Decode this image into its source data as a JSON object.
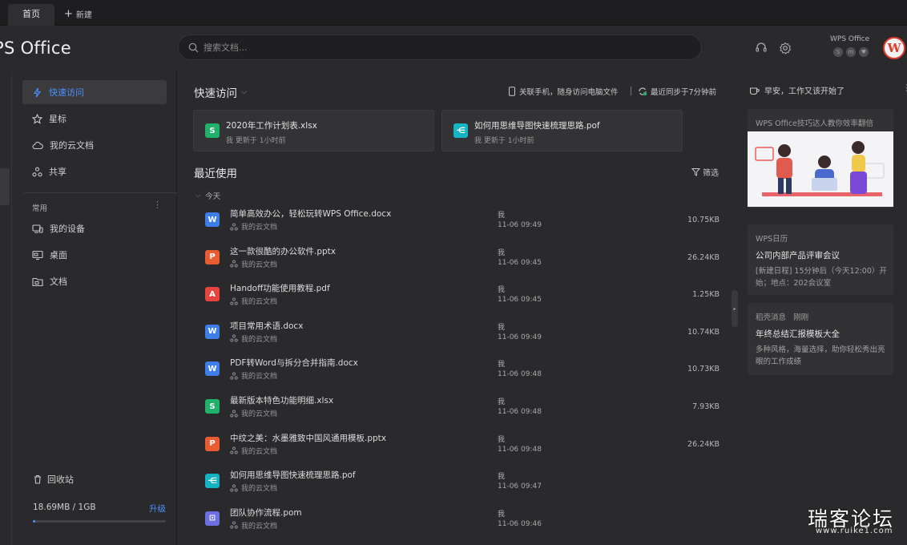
{
  "tabs": {
    "home": "首页",
    "new": "新建"
  },
  "header": {
    "logo": "PS Office",
    "search_placeholder": "搜索文档...",
    "account_name": "WPS Office",
    "badges": [
      "S",
      "m",
      "♥"
    ],
    "avatar_letter": "W"
  },
  "sidebar": {
    "items": [
      {
        "label": "快速访问",
        "icon": "lightning-icon",
        "active": true
      },
      {
        "label": "星标",
        "icon": "star-icon"
      },
      {
        "label": "我的云文档",
        "icon": "cloud-icon"
      },
      {
        "label": "共享",
        "icon": "share-icon"
      }
    ],
    "section_title": "常用",
    "common": [
      {
        "label": "我的设备",
        "icon": "device-icon"
      },
      {
        "label": "桌面",
        "icon": "desktop-icon"
      },
      {
        "label": "文档",
        "icon": "folder-icon"
      }
    ],
    "trash": "回收站",
    "storage": "18.69MB / 1GB",
    "upgrade": "升级",
    "storage_fraction": 0.018
  },
  "main": {
    "quick_access": "快速访问",
    "phone_link": "关联手机，随身访问电脑文件",
    "sync_status": "最近同步于7分钟前",
    "quick_cards": [
      {
        "title": "2020年工作计划表.xlsx",
        "sub": "我 更新于 1小时前",
        "type": "xlsx"
      },
      {
        "title": "如何用思维导图快速梳理思路.pof",
        "sub": "我 更新于 1小时前",
        "type": "mind"
      }
    ],
    "recent": "最近使用",
    "filter": "筛选",
    "today": "今天",
    "files": [
      {
        "name": "简单高效办公，轻松玩转WPS Office.docx",
        "loc": "我的云文档",
        "owner": "我",
        "time": "11-06 09:49",
        "size": "10.75KB",
        "type": "docx"
      },
      {
        "name": "这一款很酷的办公软件.pptx",
        "loc": "我的云文档",
        "owner": "我",
        "time": "11-06 09:45",
        "size": "26.24KB",
        "type": "pptx"
      },
      {
        "name": "Handoff功能使用教程.pdf",
        "loc": "我的云文档",
        "owner": "我",
        "time": "11-06 09:45",
        "size": "1.25KB",
        "type": "pdf"
      },
      {
        "name": "项目常用术语.docx",
        "loc": "我的云文档",
        "owner": "我",
        "time": "11-06 09:49",
        "size": "10.74KB",
        "type": "docx"
      },
      {
        "name": "PDF转Word与拆分合并指南.docx",
        "loc": "我的云文档",
        "owner": "我",
        "time": "11-06 09:48",
        "size": "10.73KB",
        "type": "docx"
      },
      {
        "name": "最新版本特色功能明细.xlsx",
        "loc": "我的云文档",
        "owner": "我",
        "time": "11-06 09:48",
        "size": "7.93KB",
        "type": "xlsx"
      },
      {
        "name": "中纹之美：水墨雅致中国风通用模板.pptx",
        "loc": "我的云文档",
        "owner": "我",
        "time": "11-06 09:48",
        "size": "26.24KB",
        "type": "pptx"
      },
      {
        "name": "如何用思维导图快速梳理思路.pof",
        "loc": "我的云文档",
        "owner": "我",
        "time": "11-06 09:47",
        "size": "",
        "type": "mind"
      },
      {
        "name": "团队协作流程.pom",
        "loc": "我的云文档",
        "owner": "我",
        "time": "11-06 09:46",
        "size": "",
        "type": "flow"
      }
    ]
  },
  "right": {
    "greeting": "早安，工作又该开始了",
    "tips_head": "WPS Office技巧达人教你效率翻倍",
    "calendar_head": "WPS日历",
    "calendar_title": "公司内部产品评审会议",
    "calendar_body": "[新建日程] 15分钟后（今天12:00）开始；地点：202会议室",
    "msg_head": "稻壳消息",
    "msg_time": "刚刚",
    "msg_title": "年终总结汇报模板大全",
    "msg_body": "多种风格，海量选择，助你轻松秀出亮眼的工作成绩"
  },
  "watermark": {
    "text": "瑞客论坛",
    "url": "www.ruike1.com"
  },
  "colors": {
    "accent": "#4a90ff",
    "docx": "#3d7ee8",
    "xlsx": "#1fb36a",
    "pptx": "#e85c2f",
    "pdf": "#e8433d",
    "mind": "#14b4c4",
    "flow": "#6b6fe0"
  }
}
